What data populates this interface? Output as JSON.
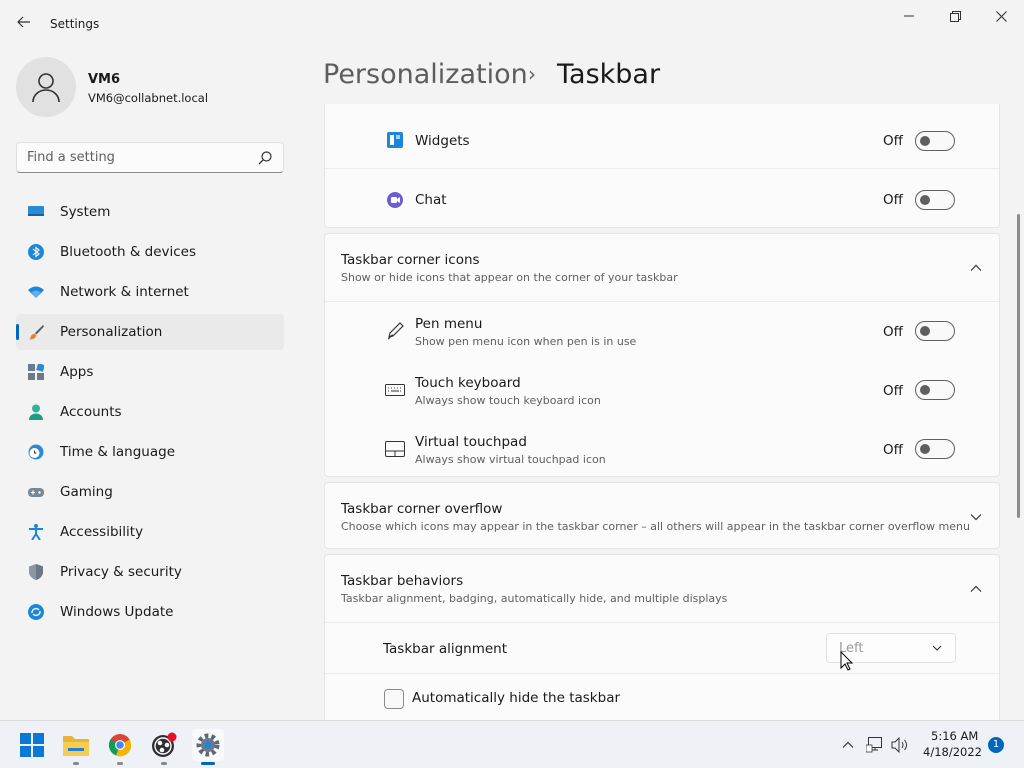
{
  "window": {
    "title": "Settings"
  },
  "user": {
    "name": "VM6",
    "email": "VM6@collabnet.local"
  },
  "search": {
    "placeholder": "Find a setting"
  },
  "nav": {
    "items": [
      {
        "label": "System",
        "icon": "monitor-icon"
      },
      {
        "label": "Bluetooth & devices",
        "icon": "bluetooth-icon"
      },
      {
        "label": "Network & internet",
        "icon": "wifi-icon"
      },
      {
        "label": "Personalization",
        "icon": "brush-icon",
        "selected": true
      },
      {
        "label": "Apps",
        "icon": "apps-icon"
      },
      {
        "label": "Accounts",
        "icon": "person-icon"
      },
      {
        "label": "Time & language",
        "icon": "clock-globe-icon"
      },
      {
        "label": "Gaming",
        "icon": "gamepad-icon"
      },
      {
        "label": "Accessibility",
        "icon": "accessibility-icon"
      },
      {
        "label": "Privacy & security",
        "icon": "shield-icon"
      },
      {
        "label": "Windows Update",
        "icon": "update-icon"
      }
    ]
  },
  "breadcrumb": {
    "parent": "Personalization",
    "separator": "›",
    "current": "Taskbar"
  },
  "taskbar_items": {
    "widgets": {
      "label": "Widgets",
      "state": "Off"
    },
    "chat": {
      "label": "Chat",
      "state": "Off"
    }
  },
  "corner_icons": {
    "title": "Taskbar corner icons",
    "description": "Show or hide icons that appear on the corner of your taskbar",
    "items": [
      {
        "label": "Pen menu",
        "description": "Show pen menu icon when pen is in use",
        "state": "Off"
      },
      {
        "label": "Touch keyboard",
        "description": "Always show touch keyboard icon",
        "state": "Off"
      },
      {
        "label": "Virtual touchpad",
        "description": "Always show virtual touchpad icon",
        "state": "Off"
      }
    ]
  },
  "corner_overflow": {
    "title": "Taskbar corner overflow",
    "description": "Choose which icons may appear in the taskbar corner – all others will appear in the taskbar corner overflow menu"
  },
  "behaviors": {
    "title": "Taskbar behaviors",
    "description": "Taskbar alignment, badging, automatically hide, and multiple displays",
    "alignment_label": "Taskbar alignment",
    "alignment_value": "Left",
    "autohide_label": "Automatically hide the taskbar"
  },
  "system_taskbar": {
    "time": "5:16 AM",
    "date": "4/18/2022",
    "notification_count": "1"
  },
  "colors": {
    "accent": "#0067c0"
  }
}
